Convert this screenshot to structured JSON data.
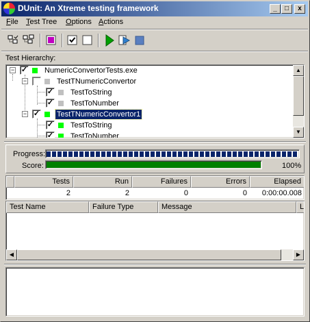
{
  "window": {
    "title": "DUnit: An Xtreme testing framework",
    "minimize": "_",
    "maximize": "□",
    "close": "x"
  },
  "menu": [
    {
      "label": "File",
      "accel": "F"
    },
    {
      "label": "Test Tree",
      "accel": "T"
    },
    {
      "label": "Options",
      "accel": "O"
    },
    {
      "label": "Actions",
      "accel": "A"
    }
  ],
  "toolbar": {
    "icons": [
      "select-all-icon",
      "deselect-all-icon",
      "select-failed-icon",
      "check-icon",
      "uncheck-icon",
      "run-icon",
      "run-selected-icon",
      "stop-icon"
    ]
  },
  "tree": {
    "label": "Test Hierarchy:",
    "nodes": [
      {
        "label": "NumericConvertorTests.exe",
        "checked": true,
        "status": "green",
        "level": 0,
        "expanded": true
      },
      {
        "label": "TestTNumericConvertor",
        "checked": false,
        "status": "gray",
        "level": 1,
        "expanded": true
      },
      {
        "label": "TestToString",
        "checked": true,
        "status": "gray",
        "level": 2
      },
      {
        "label": "TestToNumber",
        "checked": true,
        "status": "gray",
        "level": 2
      },
      {
        "label": "TestTNumericConvertor1",
        "checked": true,
        "status": "green",
        "level": 1,
        "expanded": true,
        "selected": true
      },
      {
        "label": "TestToString",
        "checked": true,
        "status": "green",
        "level": 2
      },
      {
        "label": "TestToNumber",
        "checked": true,
        "status": "green",
        "level": 2
      }
    ]
  },
  "progress": {
    "progress_label": "Progress:",
    "score_label": "Score:",
    "progress_fraction": 1.0,
    "score_fraction": 1.0,
    "score_text": "100%",
    "progress_color": "#0a246a",
    "score_color": "#008000"
  },
  "stats": {
    "headers": [
      "Tests",
      "Run",
      "Failures",
      "Errors",
      "Elapsed"
    ],
    "values": [
      "2",
      "2",
      "0",
      "0",
      "0:00:00.008"
    ]
  },
  "failures": {
    "headers": [
      "Test Name",
      "Failure Type",
      "Message",
      "L"
    ]
  }
}
